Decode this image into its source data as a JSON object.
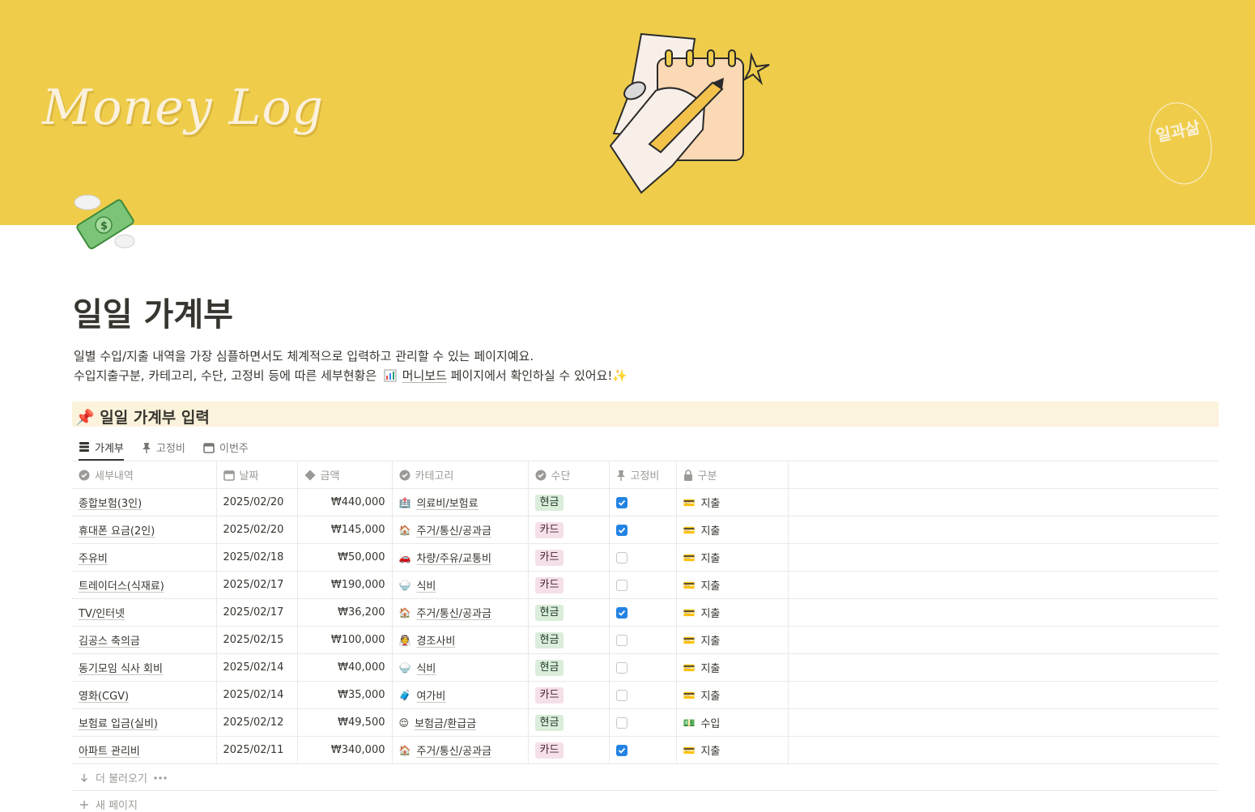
{
  "cover": {
    "title": "Money Log",
    "seal_text": "일과삶"
  },
  "page": {
    "title": "일일 가계부",
    "desc_line1": "일별 수입/지출 내역을 가장 심플하면서도 체계적으로 입력하고 관리할 수 있는 페이지예요.",
    "desc_line2_prefix": "수입지출구분, 카테고리, 수단, 고정비 등에 따른 세부현황은",
    "desc_link": "머니보드",
    "desc_line2_suffix": "페이지에서 확인하실 수 있어요!✨"
  },
  "callout": {
    "icon": "pushpin-icon",
    "text": "📌 일일 가계부 입력"
  },
  "tabs": [
    {
      "label": "가계부",
      "icon": "table-icon",
      "active": true
    },
    {
      "label": "고정비",
      "icon": "pin-icon",
      "active": false
    },
    {
      "label": "이번주",
      "icon": "calendar-icon",
      "active": false
    }
  ],
  "table": {
    "headers": [
      "세부내역",
      "날짜",
      "금액",
      "카테고리",
      "수단",
      "고정비",
      "구분"
    ],
    "rows": [
      {
        "item": "종합보험(3인)",
        "date": "2025/02/20",
        "amount": "₩440,000",
        "category": "의료비/보험료",
        "cat_icon": "🏥",
        "method": "현금",
        "method_color": "green",
        "fixed": true,
        "type": "지출",
        "type_icon": "💳"
      },
      {
        "item": "휴대폰 요금(2인)",
        "date": "2025/02/20",
        "amount": "₩145,000",
        "category": "주거/통신/공과금",
        "cat_icon": "🏠",
        "method": "카드",
        "method_color": "pink",
        "fixed": true,
        "type": "지출",
        "type_icon": "💳"
      },
      {
        "item": "주유비",
        "date": "2025/02/18",
        "amount": "₩50,000",
        "category": "차량/주유/교통비",
        "cat_icon": "🚗",
        "method": "카드",
        "method_color": "pink",
        "fixed": false,
        "type": "지출",
        "type_icon": "💳"
      },
      {
        "item": "트레이더스(식재료)",
        "date": "2025/02/17",
        "amount": "₩190,000",
        "category": "식비",
        "cat_icon": "🍚",
        "method": "카드",
        "method_color": "pink",
        "fixed": false,
        "type": "지출",
        "type_icon": "💳"
      },
      {
        "item": "TV/인터넷",
        "date": "2025/02/17",
        "amount": "₩36,200",
        "category": "주거/통신/공과금",
        "cat_icon": "🏠",
        "method": "현금",
        "method_color": "green",
        "fixed": true,
        "type": "지출",
        "type_icon": "💳"
      },
      {
        "item": "김공스 축의금",
        "date": "2025/02/15",
        "amount": "₩100,000",
        "category": "경조사비",
        "cat_icon": "👰",
        "method": "현금",
        "method_color": "green",
        "fixed": false,
        "type": "지출",
        "type_icon": "💳"
      },
      {
        "item": "동기모임 식사 회비",
        "date": "2025/02/14",
        "amount": "₩40,000",
        "category": "식비",
        "cat_icon": "🍚",
        "method": "현금",
        "method_color": "green",
        "fixed": false,
        "type": "지출",
        "type_icon": "💳"
      },
      {
        "item": "영화(CGV)",
        "date": "2025/02/14",
        "amount": "₩35,000",
        "category": "여가비",
        "cat_icon": "🧳",
        "method": "카드",
        "method_color": "pink",
        "fixed": false,
        "type": "지출",
        "type_icon": "💳"
      },
      {
        "item": "보험료 입금(실비)",
        "date": "2025/02/12",
        "amount": "₩49,500",
        "category": "보험금/환급금",
        "cat_icon": "😌",
        "method": "현금",
        "method_color": "green",
        "fixed": false,
        "type": "수입",
        "type_icon": "💵"
      },
      {
        "item": "아파트 관리비",
        "date": "2025/02/11",
        "amount": "₩340,000",
        "category": "주거/통신/공과금",
        "cat_icon": "🏠",
        "method": "카드",
        "method_color": "pink",
        "fixed": true,
        "type": "지출",
        "type_icon": "💳"
      }
    ]
  },
  "footer": {
    "load_more": "더 불러오기",
    "new_page": "새 페이지"
  }
}
